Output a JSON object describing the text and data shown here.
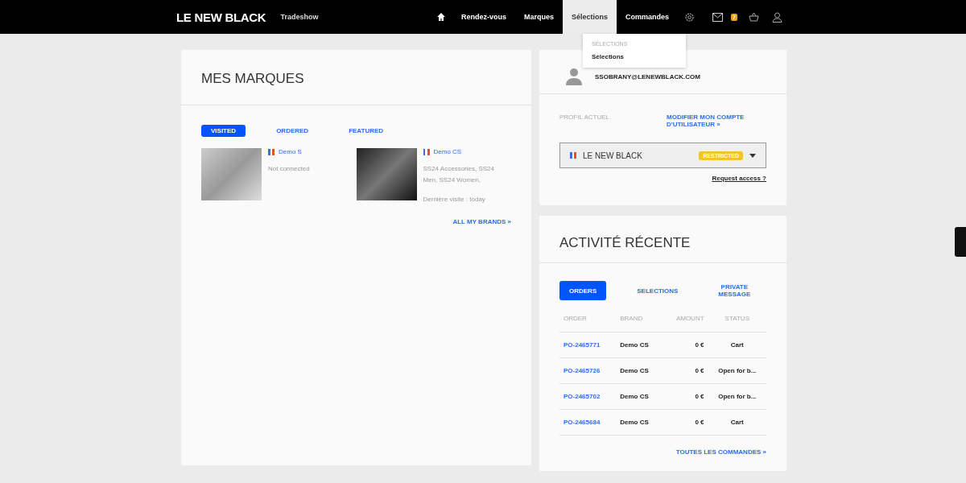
{
  "header": {
    "logo": "LE NEW BLACK",
    "context": "Tradeshow",
    "nav": [
      {
        "label": "Rendez-vous",
        "selected": false
      },
      {
        "label": "Marques",
        "selected": false
      },
      {
        "label": "Sélections",
        "selected": true
      },
      {
        "label": "Commandes",
        "selected": false
      }
    ],
    "mail_badge": "7"
  },
  "dropdown": {
    "heading": "SÉLECTIONS",
    "items": [
      "Sélections"
    ]
  },
  "brands": {
    "title": "MES MARQUES",
    "tabs": [
      {
        "label": "VISITED",
        "selected": true
      },
      {
        "label": "ORDERED",
        "selected": false
      },
      {
        "label": "FEATURED",
        "selected": false
      }
    ],
    "items": [
      {
        "name": "Demo S",
        "lines": [
          "Not connected"
        ],
        "kind": "light"
      },
      {
        "name": "Demo CS",
        "lines": [
          "SS24 Accessories, SS24 Men, SS24 Women,",
          "Dernière visite : today"
        ],
        "kind": "dark"
      }
    ],
    "more": "ALL MY BRANDS »"
  },
  "profile": {
    "email": "SSOBRANY@LENEWBLACK.COM",
    "current_label": "PROFIL ACTUEL",
    "edit_link": "MODIFIER MON COMPTE D'UTILISATEUR »",
    "company": "LE NEW BLACK",
    "badge": "RESTRICTED",
    "request": "Request access ?"
  },
  "activity": {
    "title": "ACTIVITÉ RÉCENTE",
    "tabs": [
      {
        "label": "ORDERS",
        "selected": true
      },
      {
        "label": "SELECTIONS",
        "selected": false
      },
      {
        "label": "PRIVATE MESSAGE",
        "selected": false
      }
    ],
    "columns": [
      "ORDER",
      "BRAND",
      "AMOUNT",
      "STATUS"
    ],
    "rows": [
      [
        "PO-2465771",
        "Demo CS",
        "0 €",
        "Cart"
      ],
      [
        "PO-2465726",
        "Demo CS",
        "0 €",
        "Open for b..."
      ],
      [
        "PO-2465702",
        "Demo CS",
        "0 €",
        "Open for b..."
      ],
      [
        "PO-2465684",
        "Demo CS",
        "0 €",
        "Cart"
      ]
    ],
    "more": "TOUTES LES COMMANDES »"
  }
}
